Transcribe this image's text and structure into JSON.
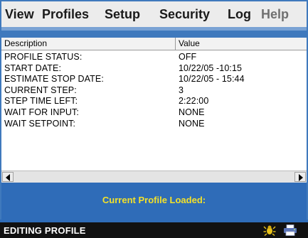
{
  "menu": [
    {
      "label": "View",
      "enabled": true
    },
    {
      "label": "Profiles",
      "enabled": true
    },
    {
      "label": "Setup",
      "enabled": true
    },
    {
      "label": "Security",
      "enabled": true
    },
    {
      "label": "Log",
      "enabled": true
    },
    {
      "label": "Help",
      "enabled": false
    }
  ],
  "table": {
    "columns": [
      "Description",
      "Value"
    ],
    "rows": [
      {
        "description": "PROFILE STATUS:",
        "value": "OFF"
      },
      {
        "description": "START DATE:",
        "value": "10/22/05 -10:15"
      },
      {
        "description": "ESTIMATE STOP DATE:",
        "value": "10/22/05 - 15:44"
      },
      {
        "description": "CURRENT STEP:",
        "value": "3"
      },
      {
        "description": "STEP TIME LEFT:",
        "value": "2:22:00"
      },
      {
        "description": "WAIT FOR INPUT:",
        "value": "NONE"
      },
      {
        "description": "WAIT SETPOINT:",
        "value": "NONE"
      }
    ]
  },
  "profile_banner": "Current Profile Loaded:",
  "status": {
    "text": "EDITING PROFILE",
    "icons": [
      "bug-icon",
      "printer-icon"
    ]
  },
  "colors": {
    "frame": "#3f79bd",
    "banner_text": "#f3e12a",
    "status_bg": "#111111"
  }
}
